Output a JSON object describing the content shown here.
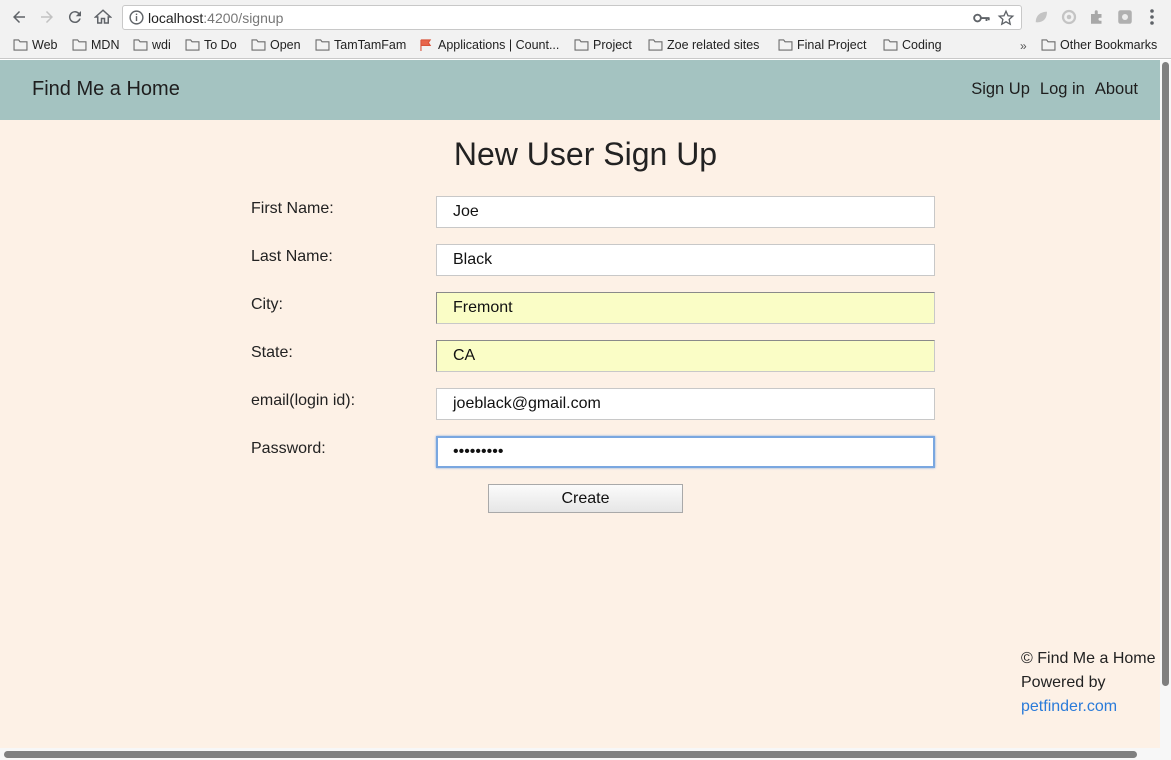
{
  "browser": {
    "url_host": "localhost",
    "url_path": ":4200/signup",
    "bookmarks": [
      "Web",
      "MDN",
      "wdi",
      "To Do",
      "Open",
      "TamTamFam",
      "Applications | Count...",
      "Project",
      "Zoe related sites",
      "Final Project",
      "Coding"
    ],
    "more_label": "»",
    "other_bookmarks": "Other Bookmarks"
  },
  "navbar": {
    "brand": "Find Me a Home",
    "links": [
      "Sign Up",
      "Log in",
      "About"
    ]
  },
  "form": {
    "title": "New User Sign Up",
    "fields": [
      {
        "label": "First Name:",
        "value": "Joe"
      },
      {
        "label": "Last Name:",
        "value": "Black"
      },
      {
        "label": "City:",
        "value": "Fremont"
      },
      {
        "label": "State:",
        "value": "CA"
      },
      {
        "label": "email(login id):",
        "value": "joeblack@gmail.com"
      },
      {
        "label": "Password:",
        "value": "•••••••••"
      }
    ],
    "submit_label": "Create"
  },
  "footer": {
    "copyright": "© Find Me a Home",
    "powered_by": "Powered by",
    "link_text": "petfinder.com"
  },
  "colors": {
    "navbar_bg": "#a4c3c1",
    "page_bg": "#fdf1e6",
    "autofill_bg": "#fafdc6",
    "link": "#2a7bd9"
  }
}
